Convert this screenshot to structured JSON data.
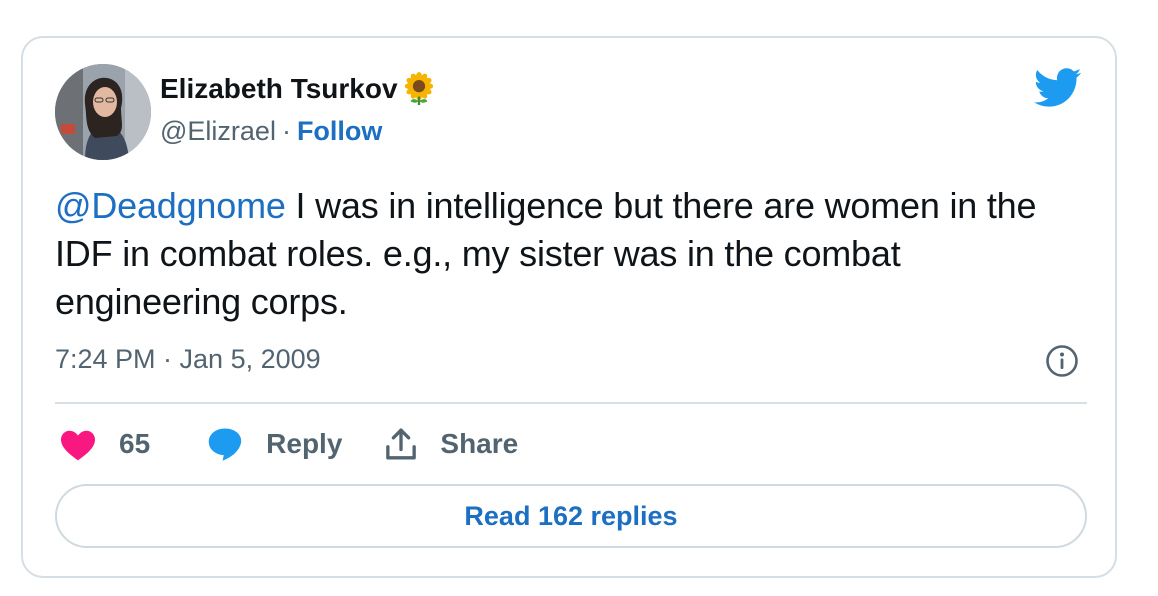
{
  "author": {
    "name": "Elizabeth Tsurkov",
    "name_emoji": "sunflower-emoji",
    "handle": "@Elizrael",
    "separator": "·",
    "follow_label": "Follow",
    "avatar": "profile-photo"
  },
  "brand": {
    "icon": "twitter-bird-icon",
    "color": "#1d9bf0"
  },
  "tweet": {
    "mention": "@Deadgnome",
    "body": " I was in intelligence but there are women in the IDF in combat roles. e.g., my sister was in the combat engineering corps.",
    "timestamp": "7:24 PM · Jan 5, 2009"
  },
  "actions": {
    "like_count": "65",
    "like_icon": "heart-icon",
    "like_color": "#f91880",
    "reply_label": "Reply",
    "reply_icon": "speech-bubble-icon",
    "reply_color": "#1d9bf0",
    "share_label": "Share",
    "share_icon": "share-upload-icon"
  },
  "footer": {
    "read_replies_label": "Read 162 replies"
  },
  "colors": {
    "link": "#1d6fc2",
    "text": "#0f1419",
    "secondary_text": "#536471",
    "border": "#d5dee4"
  }
}
